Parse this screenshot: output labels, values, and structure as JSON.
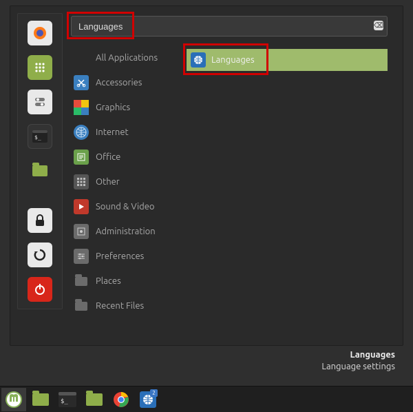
{
  "search": {
    "value": "Languages"
  },
  "categories": [
    {
      "label": "All Applications"
    },
    {
      "label": "Accessories"
    },
    {
      "label": "Graphics"
    },
    {
      "label": "Internet"
    },
    {
      "label": "Office"
    },
    {
      "label": "Other"
    },
    {
      "label": "Sound & Video"
    },
    {
      "label": "Administration"
    },
    {
      "label": "Preferences"
    },
    {
      "label": "Places"
    },
    {
      "label": "Recent Files"
    }
  ],
  "result": {
    "label": "Languages"
  },
  "tooltip": {
    "title": "Languages",
    "subtitle": "Language settings"
  },
  "taskbar": {
    "badge": "2"
  }
}
